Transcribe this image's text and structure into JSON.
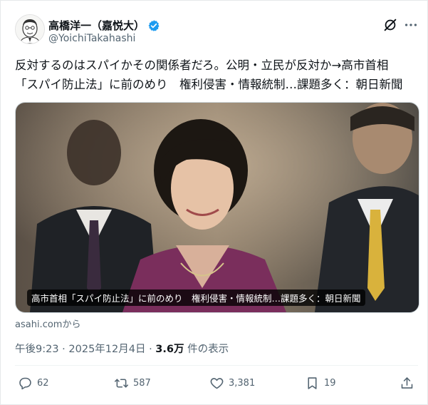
{
  "author": {
    "display_name": "高橋洋一（嘉悦大）",
    "handle": "@YoichiTakahashi",
    "verified_color": "#1d9bf0"
  },
  "tweet": {
    "line1": "反対するのはスパイかその関係者だろ。公明・立民が反対か→高市首相",
    "line2": "「スパイ防止法」に前のめり　権利侵害・情報統制…課題多く：朝日新聞"
  },
  "card": {
    "caption": "高市首相「スパイ防止法」に前のめり　権利侵害・情報統制…課題多く：朝日新聞",
    "source": "asahi.comから"
  },
  "meta": {
    "time": "午後9:23 · 2025年12月4日 · ",
    "views": "3.6万",
    "views_suffix": " 件の表示"
  },
  "actions": {
    "replies": "62",
    "reposts": "587",
    "likes": "3,381",
    "bookmarks": "19"
  },
  "icons": [
    "grok-icon",
    "more-icon",
    "verified-badge-icon",
    "reply-icon",
    "repost-icon",
    "like-icon",
    "bookmark-icon",
    "share-icon"
  ]
}
